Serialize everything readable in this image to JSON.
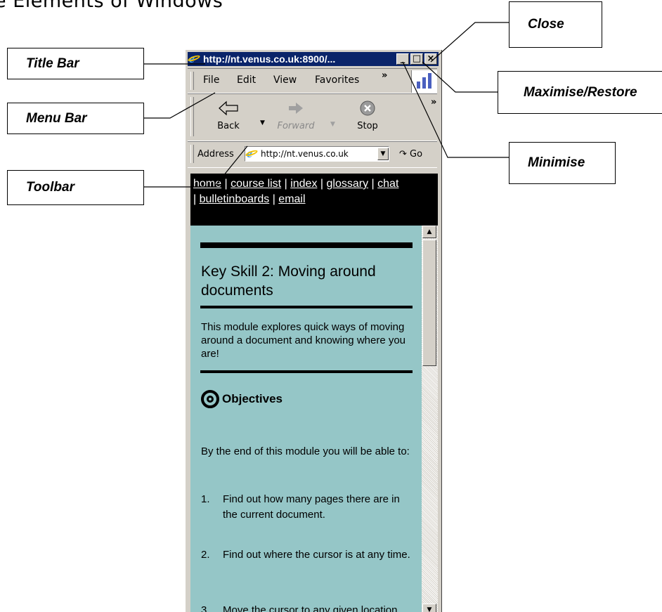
{
  "heading": "e Elements of Windows",
  "callouts": {
    "title_bar": "Title Bar",
    "menu_bar": "Menu Bar",
    "toolbar": "Toolbar",
    "close": "Close",
    "maximise_restore": "Maximise/Restore",
    "minimise": "Minimise"
  },
  "window": {
    "title": "http://nt.venus.co.uk:8900/...",
    "buttons": {
      "minimise": "_",
      "maximise": "□",
      "close": "×"
    },
    "menu": [
      "File",
      "Edit",
      "View",
      "Favorites"
    ],
    "more_chevron": "»",
    "toolbar": {
      "back": "Back",
      "forward": "Forward",
      "stop": "Stop"
    },
    "address": {
      "label": "Address",
      "value": "http://nt.venus.co.uk",
      "go": "Go"
    }
  },
  "nav_links": {
    "home": "home",
    "course_list": "course list",
    "index": "index",
    "glossary": "glossary",
    "chat": "chat",
    "bulletinboards": "bulletinboards",
    "email": "email",
    "sep": "|"
  },
  "page": {
    "title": "Key Skill 2: Moving around documents",
    "intro": "This module explores quick ways of moving around a document and knowing where you are!",
    "objectives_heading": "Objectives",
    "lead": "By the end of this module you will be able to:",
    "items": [
      {
        "num": "1.",
        "text": "Find out how many pages there are in the current document."
      },
      {
        "num": "2.",
        "text": "Find out where the cursor is at any time."
      },
      {
        "num": "3.",
        "text": "Move the cursor to any given location."
      }
    ]
  },
  "colors": {
    "title_bar": "#0a246a",
    "chrome": "#d4d0c8",
    "content_bg": "#95c6c7",
    "nav_bg": "#000000"
  }
}
